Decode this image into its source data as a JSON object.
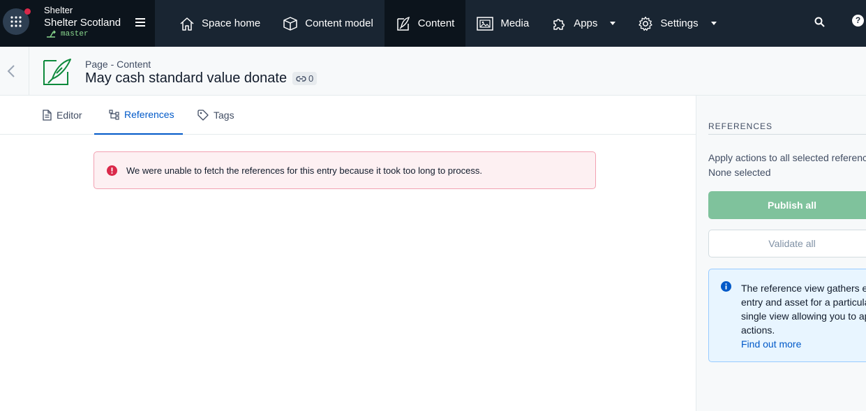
{
  "topnav": {
    "org_name": "Shelter",
    "space_name": "Shelter Scotland",
    "environment": "master",
    "items": [
      {
        "label": "Space home",
        "icon": "home-icon"
      },
      {
        "label": "Content model",
        "icon": "content-model-icon"
      },
      {
        "label": "Content",
        "icon": "content-icon",
        "active": true
      },
      {
        "label": "Media",
        "icon": "media-icon"
      },
      {
        "label": "Apps",
        "icon": "puzzle-icon",
        "dropdown": true
      },
      {
        "label": "Settings",
        "icon": "gear-icon",
        "dropdown": true
      }
    ],
    "help_label": "?"
  },
  "entry": {
    "content_type": "Page - Content",
    "title": "May cash standard value donate",
    "reference_count": "0"
  },
  "tabs": [
    {
      "label": "Editor"
    },
    {
      "label": "References",
      "active": true
    },
    {
      "label": "Tags"
    }
  ],
  "error_message": "We were unable to fetch the references for this entry because it took too long to process.",
  "sidebar": {
    "title": "REFERENCES",
    "description": "Apply actions to all selected references",
    "selected": "None selected",
    "publish_label": "Publish all",
    "validate_label": "Validate all",
    "info_lines": [
      "The reference view gathers every",
      "entry and asset for a particular",
      "single view allowing you to apply",
      "actions."
    ],
    "info_link": "Find out more"
  },
  "colors": {
    "nav_bg": "#192532",
    "nav_active": "#0c141c",
    "primary": "#0059c8",
    "positive_disabled": "#7fc29c",
    "error_bg": "#fdf0f2",
    "info_bg": "#e8f5ff",
    "brand_green": "#0e8a3c"
  }
}
